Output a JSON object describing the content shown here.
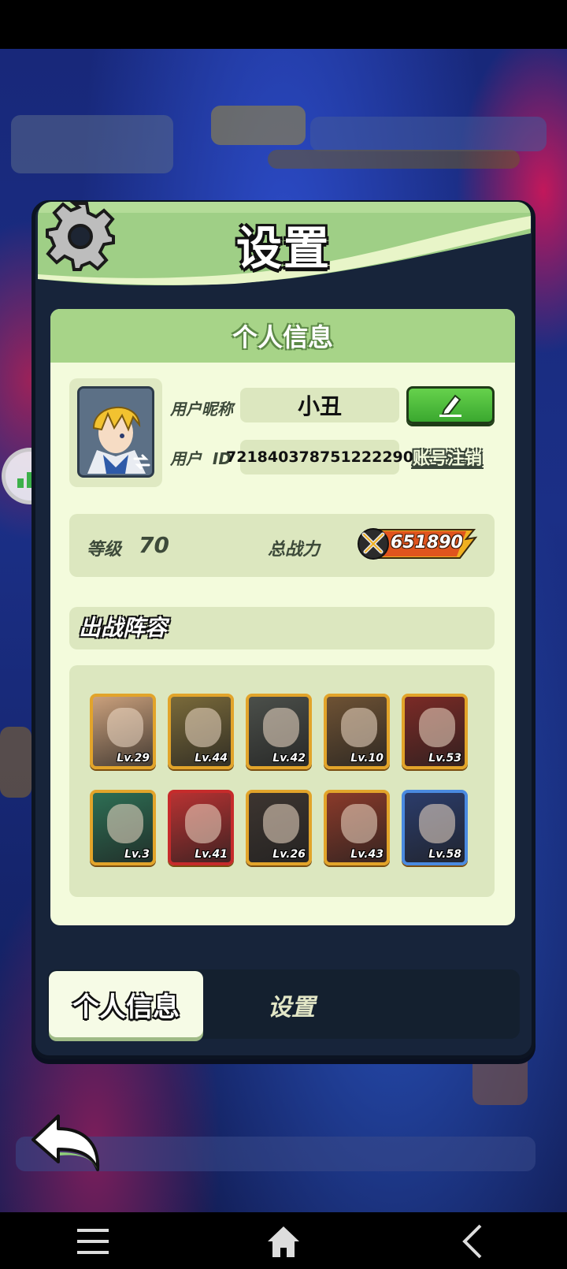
{
  "dialog": {
    "title": "设置",
    "card_header": "个人信息"
  },
  "profile": {
    "nickname_label": "用户昵称",
    "nickname": "小丑",
    "id_label": "用户  ID",
    "user_id": "721840378751222290",
    "cancel_account": "账号注销"
  },
  "stats": {
    "level_label": "等级",
    "level": "70",
    "power_label": "总战力",
    "power": "651890"
  },
  "lineup": {
    "title": "出战阵容",
    "heroes": [
      {
        "level": "Lv.29",
        "color": "#caa07c"
      },
      {
        "level": "Lv.44",
        "color": "#7a6a3a"
      },
      {
        "level": "Lv.42",
        "color": "#4b4f4a"
      },
      {
        "level": "Lv.10",
        "color": "#6e5234"
      },
      {
        "level": "Lv.53",
        "color": "#7b2a26"
      },
      {
        "level": "Lv.3",
        "color": "#2d6e54"
      },
      {
        "level": "Lv.41",
        "color": "#b83232"
      },
      {
        "level": "Lv.26",
        "color": "#3d3530"
      },
      {
        "level": "Lv.43",
        "color": "#8a3a2a"
      },
      {
        "level": "Lv.58",
        "color": "#2b3c6b"
      }
    ]
  },
  "tabs": {
    "personal_info": "个人信息",
    "settings": "设置"
  },
  "colors": {
    "header_green": "#a7d488",
    "card_bg": "#f3fbdc",
    "edit_button": "#4cbc3a"
  }
}
